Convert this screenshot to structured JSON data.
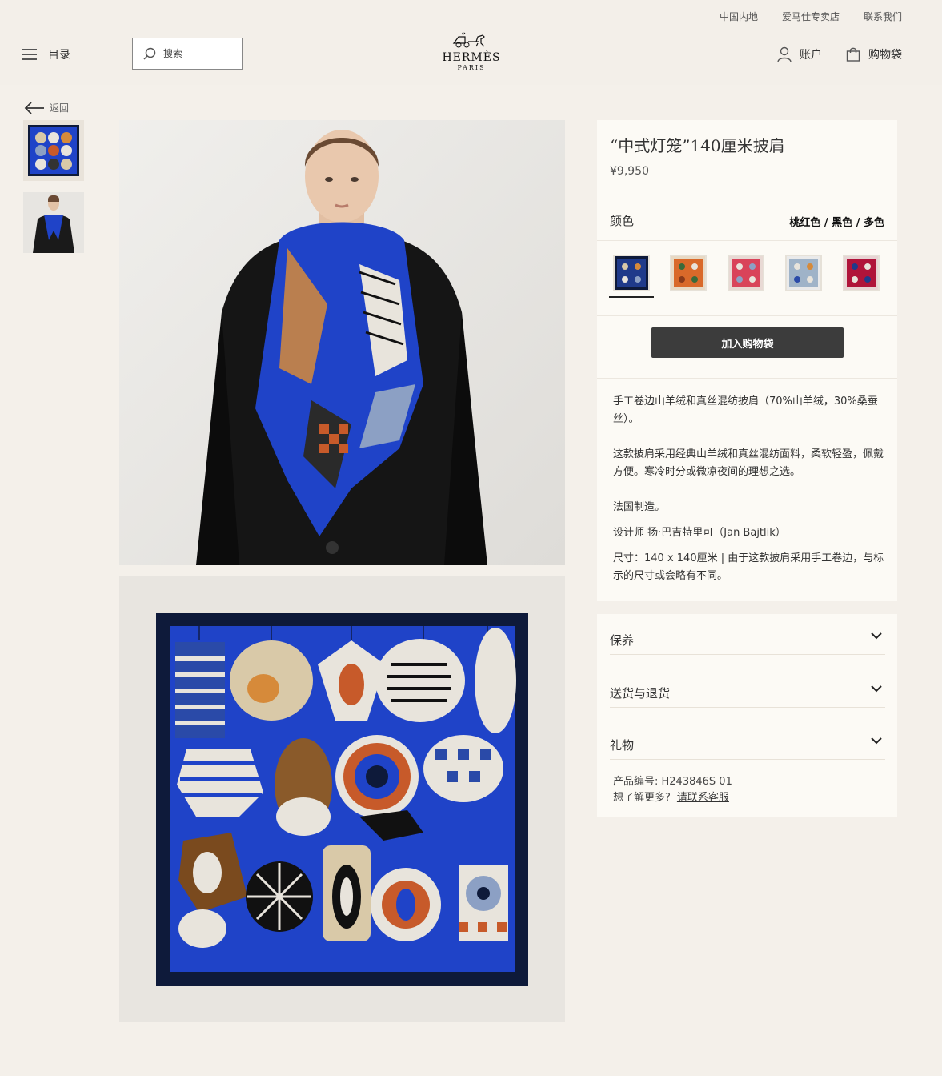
{
  "header": {
    "util_links": [
      "中国内地",
      "爱马仕专卖店",
      "联系我们"
    ],
    "menu_label": "目录",
    "search_placeholder": "搜索",
    "logo_brand": "HERMÈS",
    "logo_city": "PARIS",
    "account_label": "账户",
    "bag_label": "购物袋"
  },
  "nav": {
    "back_label": "返回"
  },
  "product": {
    "title": "“中式灯笼”140厘米披肩",
    "price": "¥9,950",
    "color_label": "颜色",
    "color_value": "桃红色 / 黑色 / 多色",
    "add_to_bag": "加入购物袋",
    "description": {
      "p1": "手工卷边山羊绒和真丝混纺披肩（70%山羊绒，30%桑蚕丝）。",
      "p2": "这款披肩采用经典山羊绒和真丝混纺面料，柔软轻盈，佩戴方便。寒冷时分或微凉夜间的理想之选。",
      "p3": "法国制造。",
      "p4": "设计师 扬·巴吉特里可（Jan Bajtlik）",
      "p5": "尺寸：140 x 140厘米 | 由于这款披肩采用手工卷边，与标示的尺寸或会略有不同。"
    }
  },
  "accordion": {
    "items": [
      "保养",
      "送货与退货",
      "礼物"
    ],
    "product_number": "产品编号:   H243846S 01",
    "more_prefix": "想了解更多?",
    "more_link": "请联系客服"
  },
  "colors": {
    "swatches": [
      "#1f3a8a",
      "#d9692a",
      "#d9435a",
      "#9fb3c8",
      "#b0143a"
    ],
    "scarf_blue": "#1f43c8",
    "scarf_border": "#0e1a3a",
    "button": "#3c3c3c"
  }
}
